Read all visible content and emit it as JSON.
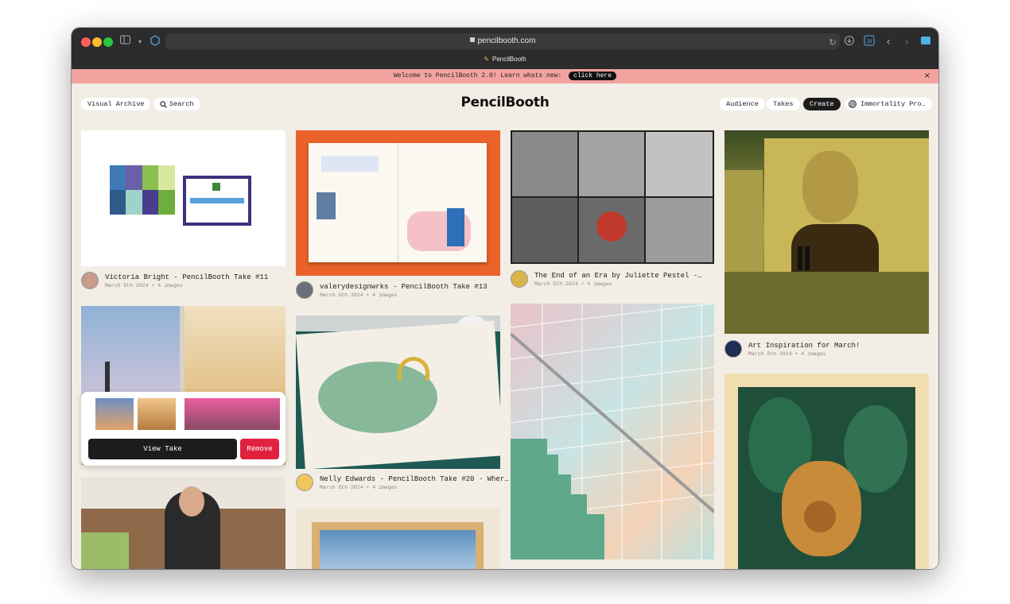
{
  "browser": {
    "url": "pencilbooth.com",
    "tab_title": "PencilBooth",
    "icons": [
      "sidebar-icon",
      "chevron-down-icon",
      "shield-icon",
      "reload-icon",
      "download-icon",
      "js-icon",
      "back-icon",
      "forward-icon",
      "extension-icon"
    ]
  },
  "banner": {
    "text": "Welcome to PencilBooth 2.0! Learn whats new:",
    "button": "click here",
    "close": "×"
  },
  "nav": {
    "visual_archive": "Visual Archive",
    "search": "Search",
    "logo": "PencilBooth",
    "audience": "Audience",
    "takes": "Takes",
    "create": "Create",
    "account": "Immortality Pro…"
  },
  "cards": [
    {
      "title": "Victoria Bright - PencilBooth Take #11",
      "sub": "March 5th 2024 • 4 images"
    },
    {
      "title": "valerydesignwrks - PencilBooth Take #13",
      "sub": "March 5th 2024 • 4 images"
    },
    {
      "title": "The End of an Era by Juliette Pestel -…",
      "sub": "March 5th 2024 • 4 images"
    },
    {
      "title": "Art Inspiration for March!",
      "sub": "March 5th 2024 • 4 images"
    },
    {
      "title": "Nelly Edwards - PencilBooth Take #20 - Wher…",
      "sub": "March 5th 2024 • 4 images"
    }
  ],
  "popup": {
    "view": "View Take",
    "remove": "Remove"
  },
  "colors": {
    "banner": "#f2a39f",
    "page": "#f2ede5",
    "remove": "#e0223f",
    "dark": "#1c1c1c"
  }
}
